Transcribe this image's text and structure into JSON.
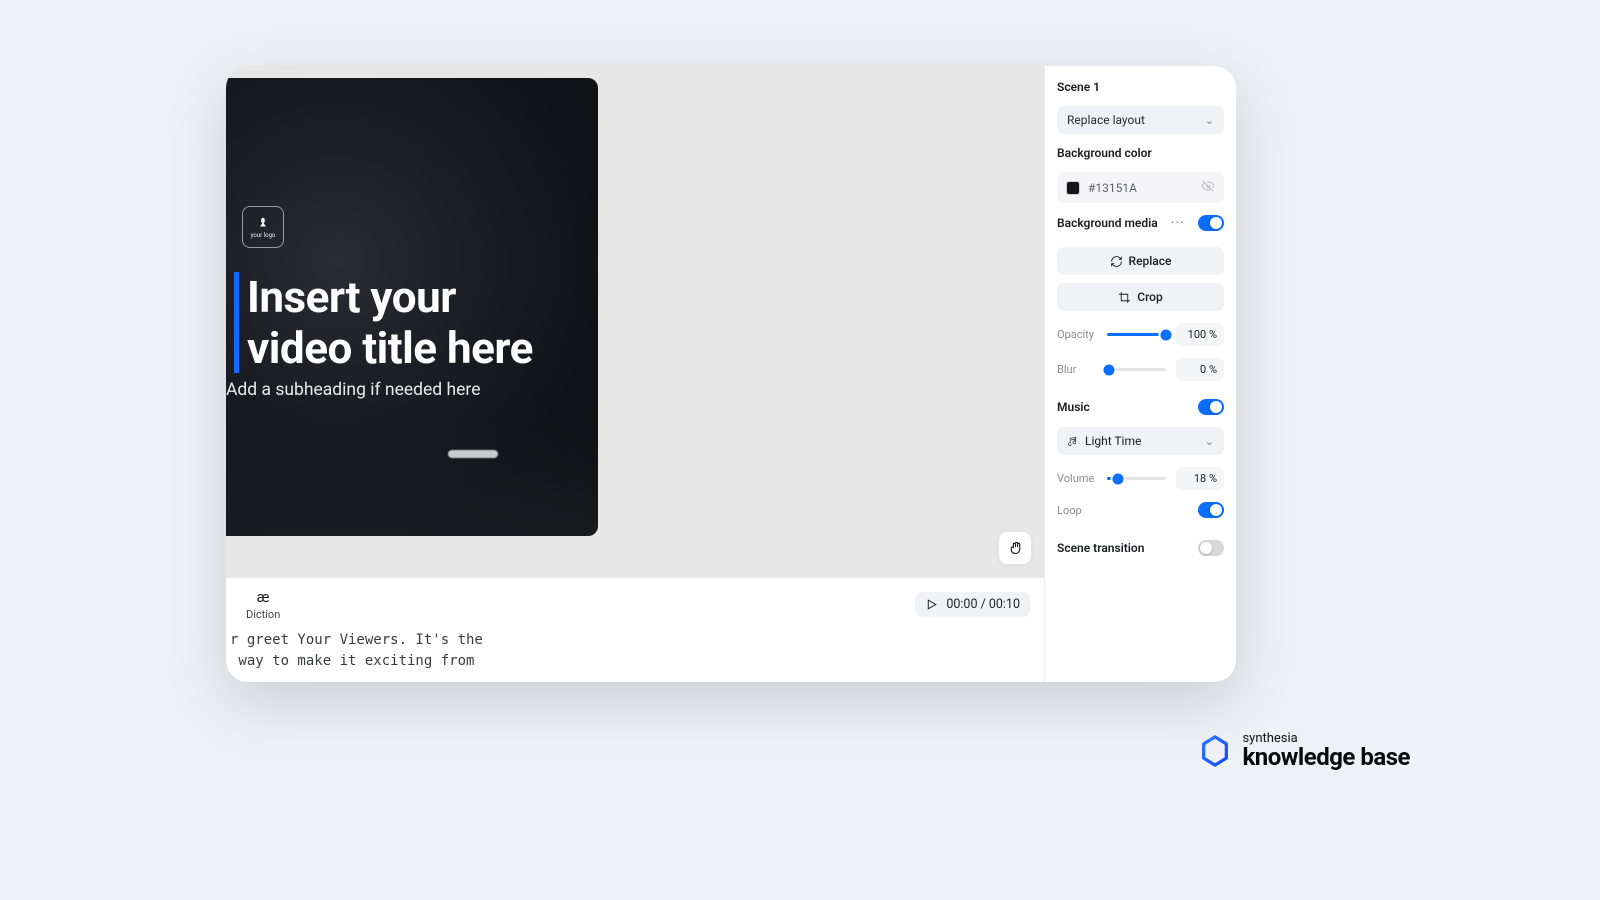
{
  "stage": {
    "logo_text": "your logo",
    "title_line1": "Insert your",
    "title_line2": "video title here",
    "subtitle": "Add a subheading if needed here"
  },
  "script": {
    "diction_label": "Diction",
    "diction_symbol": "æ",
    "play_current": "00:00",
    "play_total": "00:10",
    "line1": "r greet Your Viewers. It's the",
    "line2": " way to make it exciting from"
  },
  "inspector": {
    "scene_title": "Scene 1",
    "replace_layout": "Replace layout",
    "bg_color_label": "Background color",
    "bg_color_hex": "#13151A",
    "bg_media_label": "Background media",
    "bg_media_on": true,
    "replace_label": "Replace",
    "crop_label": "Crop",
    "opacity_label": "Opacity",
    "opacity_value": "100",
    "opacity_unit": "%",
    "blur_label": "Blur",
    "blur_value": "0",
    "blur_unit": "%",
    "music_label": "Music",
    "music_on": true,
    "music_track": "Light Time",
    "volume_label": "Volume",
    "volume_value": "18",
    "volume_unit": "%",
    "loop_label": "Loop",
    "loop_on": true,
    "transition_label": "Scene transition",
    "transition_on": false
  },
  "footer": {
    "small": "synthesia",
    "big": "knowledge base"
  }
}
